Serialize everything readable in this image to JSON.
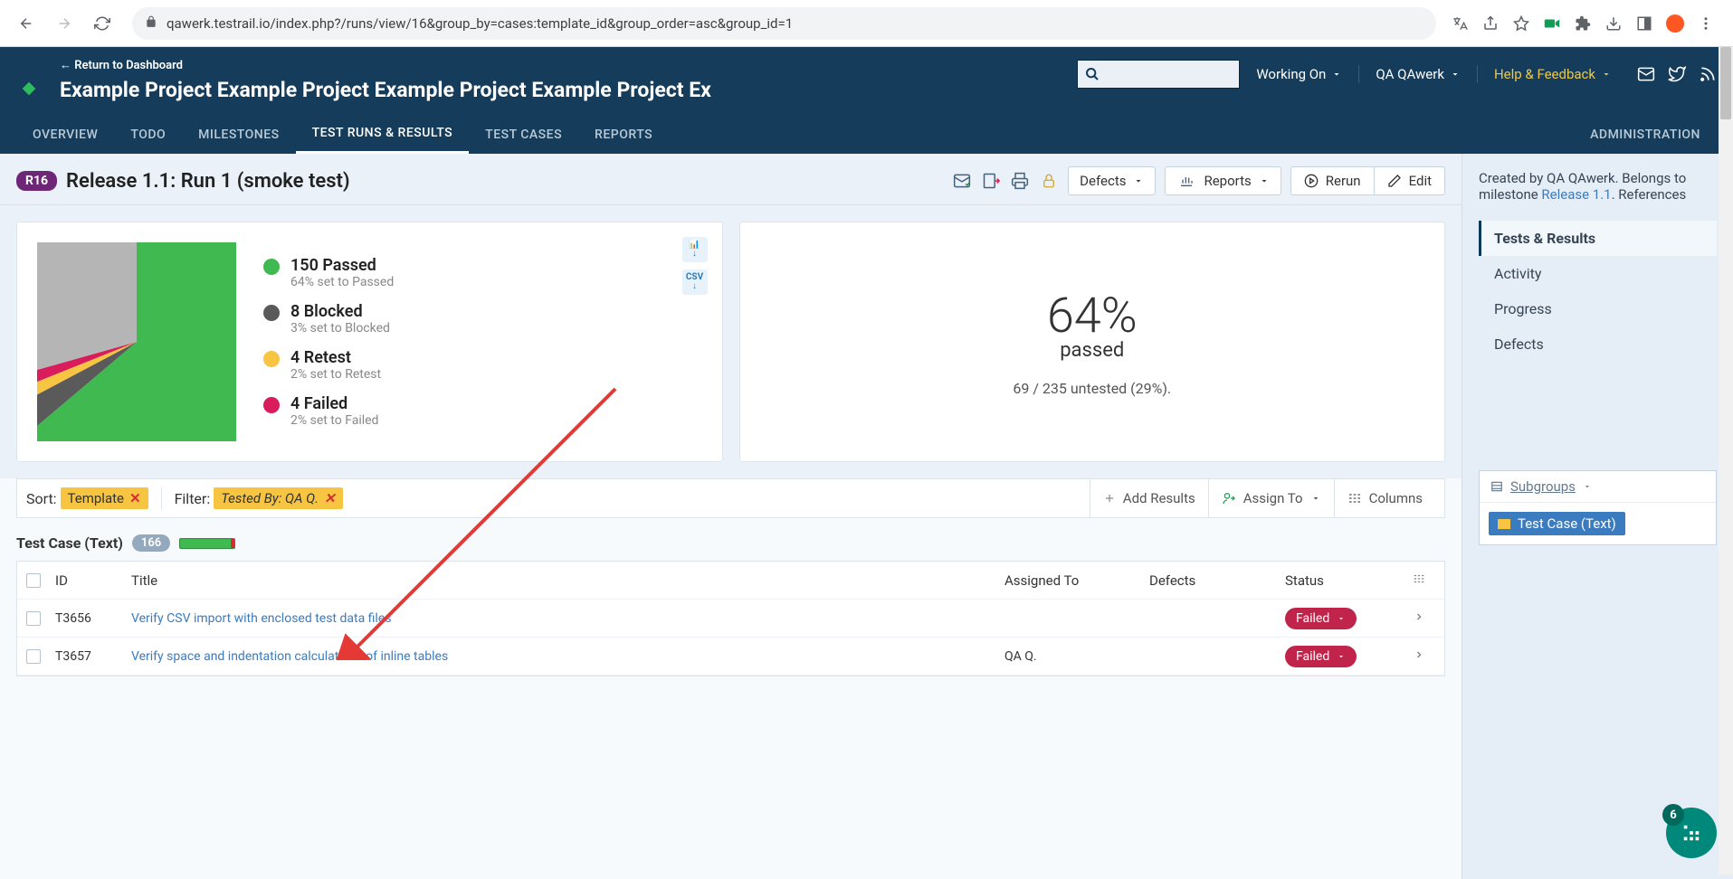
{
  "browser": {
    "url": "qawerk.testrail.io/index.php?/runs/view/16&group_by=cases:template_id&group_order=asc&group_id=1"
  },
  "header": {
    "return_link": "← Return to Dashboard",
    "project_title": "Example Project Example Project Example Project Example Project Exampl",
    "menu_working": "Working On",
    "menu_user": "QA QAwerk",
    "menu_help": "Help & Feedback",
    "tabs": [
      "OVERVIEW",
      "TODO",
      "MILESTONES",
      "TEST RUNS & RESULTS",
      "TEST CASES",
      "REPORTS"
    ],
    "active_tab": 3,
    "admin_tab": "ADMINISTRATION"
  },
  "page": {
    "badge": "R16",
    "title": "Release 1.1: Run 1 (smoke test)",
    "btn_defects": "Defects",
    "btn_reports": "Reports",
    "btn_rerun": "Rerun",
    "btn_edit": "Edit"
  },
  "chart_data": {
    "type": "pie",
    "series": [
      {
        "name": "Passed",
        "value": 150,
        "pct_label": "64% set to Passed",
        "color": "#3fb950"
      },
      {
        "name": "Blocked",
        "value": 8,
        "pct_label": "3% set to Blocked",
        "color": "#5a5a5a"
      },
      {
        "name": "Retest",
        "value": 4,
        "pct_label": "2% set to Retest",
        "color": "#f7c542"
      },
      {
        "name": "Failed",
        "value": 4,
        "pct_label": "2% set to Failed",
        "color": "#d81c5c"
      }
    ],
    "untested": {
      "value": 69,
      "total": 235,
      "pct": 29,
      "color": "#b5b5b5"
    },
    "summary": {
      "big_pct": "64%",
      "big_label": "passed",
      "sub": "69 / 235 untested (29%)."
    },
    "legend_labels": [
      "150 Passed",
      "8 Blocked",
      "4 Retest",
      "4 Failed"
    ]
  },
  "toolbar": {
    "sort_label": "Sort:",
    "sort_value": "Template",
    "filter_label": "Filter:",
    "filter_value": "Tested By: QA Q.",
    "add_results": "Add Results",
    "assign_to": "Assign To",
    "columns": "Columns"
  },
  "group": {
    "title": "Test Case (Text)",
    "count": "166"
  },
  "table": {
    "headers": {
      "id": "ID",
      "title": "Title",
      "assigned": "Assigned To",
      "defects": "Defects",
      "status": "Status"
    },
    "rows": [
      {
        "id": "T3656",
        "title": "Verify CSV import with enclosed test data files",
        "assigned": "",
        "defects": "",
        "status": "Failed"
      },
      {
        "id": "T3657",
        "title": "Verify space and indentation calculations of inline tables",
        "assigned": "QA Q.",
        "defects": "",
        "status": "Failed"
      }
    ]
  },
  "sidebar": {
    "meta_prefix": "Created by QA QAwerk. Belongs to milestone ",
    "meta_link": "Release 1.1",
    "meta_suffix": ". References",
    "nav": [
      "Tests & Results",
      "Activity",
      "Progress",
      "Defects"
    ],
    "nav_active": 0,
    "subgroups_label": "Subgroups",
    "subgroup_item": "Test Case (Text)"
  },
  "fab": {
    "badge": "6"
  }
}
